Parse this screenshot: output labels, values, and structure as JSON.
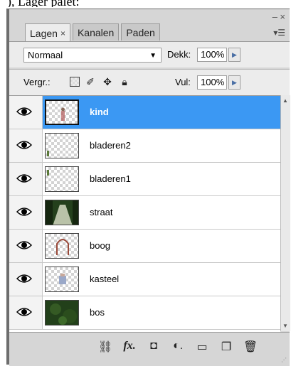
{
  "panel": {
    "tabs": [
      {
        "label": "Lagen",
        "active": true,
        "close": "×"
      },
      {
        "label": "Kanalen",
        "active": false
      },
      {
        "label": "Paden",
        "active": false
      }
    ],
    "window_controls": "– ×",
    "menu_glyph": "▾☰"
  },
  "blend": {
    "mode": "Normaal",
    "opacity_label": "Dekk:",
    "opacity_value": "100%",
    "fill_label": "Vul:",
    "fill_value": "100%"
  },
  "lock": {
    "label": "Vergr.:",
    "icons": [
      "lock-transparent-icon",
      "brush-icon",
      "move-icon",
      "padlock-icon"
    ]
  },
  "layers": [
    {
      "name": "kind",
      "selected": true,
      "visible": true
    },
    {
      "name": "bladeren2",
      "selected": false,
      "visible": true
    },
    {
      "name": "bladeren1",
      "selected": false,
      "visible": true
    },
    {
      "name": "straat",
      "selected": false,
      "visible": true
    },
    {
      "name": "boog",
      "selected": false,
      "visible": true
    },
    {
      "name": "kasteel",
      "selected": false,
      "visible": true
    },
    {
      "name": "bos",
      "selected": false,
      "visible": true
    }
  ],
  "bottom_icons": [
    "link-icon",
    "fx-icon",
    "mask-icon",
    "adjustment-icon",
    "folder-icon",
    "new-layer-icon",
    "trash-icon"
  ],
  "colors": {
    "selection": "#3b98f3",
    "panel": "#d6d6d6"
  }
}
